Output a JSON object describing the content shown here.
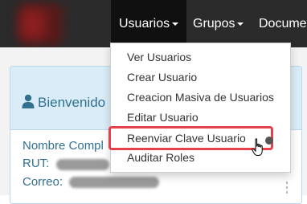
{
  "nav": {
    "usuarios_label": "Usuarios",
    "grupos_label": "Grupos",
    "documentos_label": "Docume"
  },
  "dropdown": {
    "items": [
      {
        "label": "Ver Usuarios"
      },
      {
        "label": "Crear Usuario"
      },
      {
        "label": "Creacion Masiva de Usuarios"
      },
      {
        "label": "Editar Usuario"
      },
      {
        "label": "Reenviar Clave Usuario"
      },
      {
        "label": "Auditar Roles"
      }
    ]
  },
  "panel": {
    "welcome_text": "Bienvenido",
    "nombre_label": "Nombre Compl",
    "rut_label": "RUT:",
    "correo_label": "Correo:"
  },
  "colors": {
    "navbar": "#2b2b2b",
    "highlight": "#e8404a",
    "info_text": "#31708f"
  },
  "icons": [
    "user-icon",
    "caret-down-icon",
    "hand-pointer-icon"
  ]
}
